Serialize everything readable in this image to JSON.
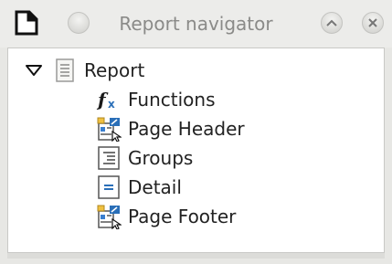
{
  "window": {
    "title": "Report navigator"
  },
  "tree": {
    "root": {
      "label": "Report",
      "icon": "report-icon",
      "expanded": true
    },
    "children": [
      {
        "label": "Functions",
        "icon": "functions-icon"
      },
      {
        "label": "Page Header",
        "icon": "page-section-icon"
      },
      {
        "label": "Groups",
        "icon": "groups-icon"
      },
      {
        "label": "Detail",
        "icon": "detail-icon"
      },
      {
        "label": "Page Footer",
        "icon": "page-section-icon"
      }
    ]
  },
  "colors": {
    "background": "#e7e7e4",
    "panel": "#ffffff",
    "icon_blue": "#2a6fb8"
  }
}
